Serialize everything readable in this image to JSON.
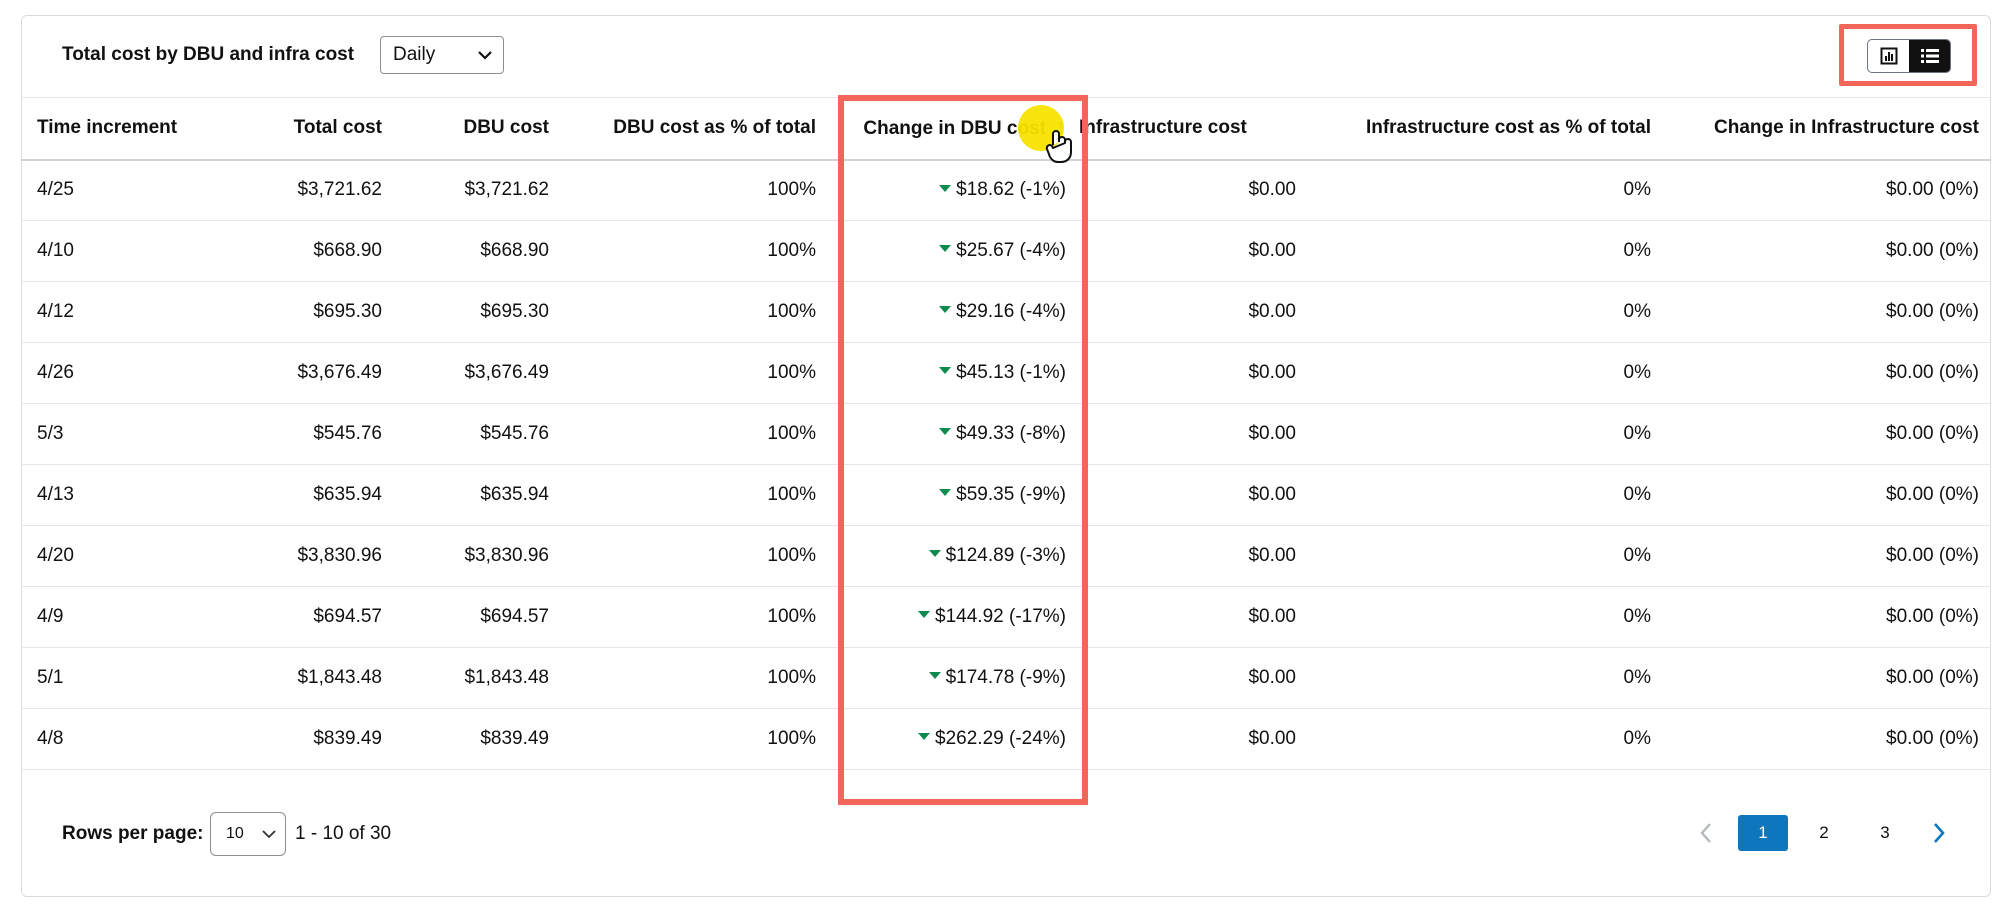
{
  "toolbar": {
    "title": "Total cost by DBU and infra cost",
    "granularity_value": "Daily"
  },
  "view_toggle": {
    "options": [
      "chart-view-icon",
      "table-view-icon"
    ],
    "active": "table-view-icon"
  },
  "table": {
    "columns": [
      "Time increment",
      "Total cost",
      "DBU cost",
      "DBU cost as % of total",
      "Change in DBU cost",
      "Infrastructure cost",
      "Infrastructure cost as % of total",
      "Change in Infrastructure cost"
    ],
    "sort": {
      "column": "Change in DBU cost",
      "direction": "ascending",
      "indicator": "↑"
    },
    "rows": [
      {
        "time": "4/25",
        "total": "$3,721.62",
        "dbu": "$3,721.62",
        "dbu_pct": "100%",
        "dbu_change": "$18.62 (-1%)",
        "infra": "$0.00",
        "infra_pct": "0%",
        "infra_change": "$0.00 (0%)"
      },
      {
        "time": "4/10",
        "total": "$668.90",
        "dbu": "$668.90",
        "dbu_pct": "100%",
        "dbu_change": "$25.67 (-4%)",
        "infra": "$0.00",
        "infra_pct": "0%",
        "infra_change": "$0.00 (0%)"
      },
      {
        "time": "4/12",
        "total": "$695.30",
        "dbu": "$695.30",
        "dbu_pct": "100%",
        "dbu_change": "$29.16 (-4%)",
        "infra": "$0.00",
        "infra_pct": "0%",
        "infra_change": "$0.00 (0%)"
      },
      {
        "time": "4/26",
        "total": "$3,676.49",
        "dbu": "$3,676.49",
        "dbu_pct": "100%",
        "dbu_change": "$45.13 (-1%)",
        "infra": "$0.00",
        "infra_pct": "0%",
        "infra_change": "$0.00 (0%)"
      },
      {
        "time": "5/3",
        "total": "$545.76",
        "dbu": "$545.76",
        "dbu_pct": "100%",
        "dbu_change": "$49.33 (-8%)",
        "infra": "$0.00",
        "infra_pct": "0%",
        "infra_change": "$0.00 (0%)"
      },
      {
        "time": "4/13",
        "total": "$635.94",
        "dbu": "$635.94",
        "dbu_pct": "100%",
        "dbu_change": "$59.35 (-9%)",
        "infra": "$0.00",
        "infra_pct": "0%",
        "infra_change": "$0.00 (0%)"
      },
      {
        "time": "4/20",
        "total": "$3,830.96",
        "dbu": "$3,830.96",
        "dbu_pct": "100%",
        "dbu_change": "$124.89 (-3%)",
        "infra": "$0.00",
        "infra_pct": "0%",
        "infra_change": "$0.00 (0%)"
      },
      {
        "time": "4/9",
        "total": "$694.57",
        "dbu": "$694.57",
        "dbu_pct": "100%",
        "dbu_change": "$144.92 (-17%)",
        "infra": "$0.00",
        "infra_pct": "0%",
        "infra_change": "$0.00 (0%)"
      },
      {
        "time": "5/1",
        "total": "$1,843.48",
        "dbu": "$1,843.48",
        "dbu_pct": "100%",
        "dbu_change": "$174.78 (-9%)",
        "infra": "$0.00",
        "infra_pct": "0%",
        "infra_change": "$0.00 (0%)"
      },
      {
        "time": "4/8",
        "total": "$839.49",
        "dbu": "$839.49",
        "dbu_pct": "100%",
        "dbu_change": "$262.29 (-24%)",
        "infra": "$0.00",
        "infra_pct": "0%",
        "infra_change": "$0.00 (0%)"
      }
    ]
  },
  "footer": {
    "rows_per_page_label": "Rows per page:",
    "rows_per_page_value": "10",
    "range_text": "1 - 10 of 30",
    "pages": [
      "1",
      "2",
      "3"
    ],
    "current_page": "1"
  },
  "colors": {
    "highlight": "#f2665a",
    "decrease_indicator": "#0f8a4f",
    "active_page": "#0e76bd",
    "cursor_spot": "#f7e300"
  }
}
